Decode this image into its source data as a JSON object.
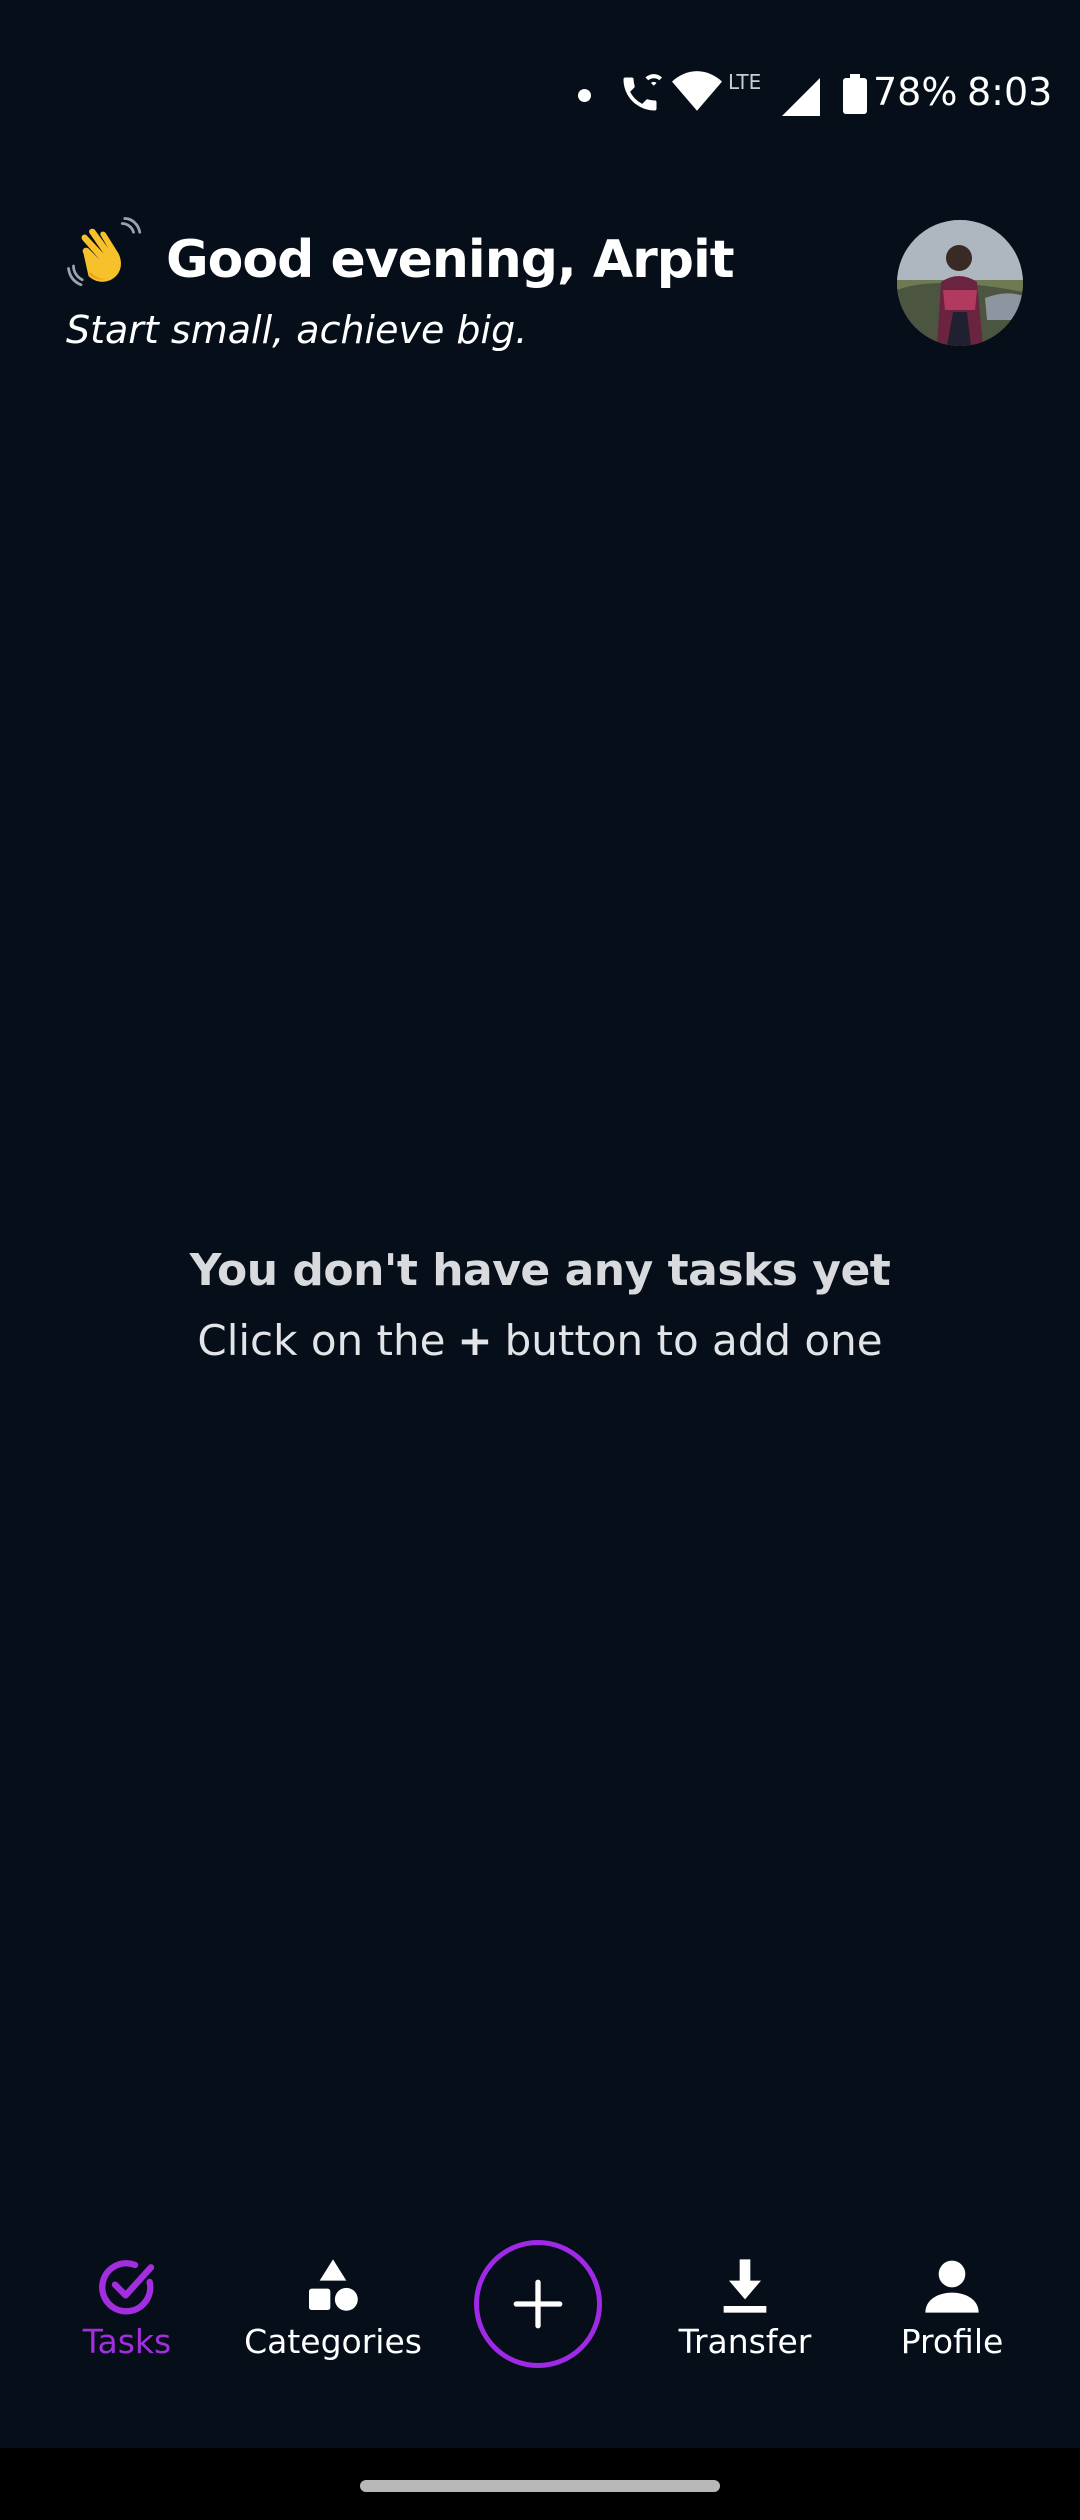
{
  "status_bar": {
    "lte_label": "LTE",
    "battery_percent": "78%",
    "time": "8:03"
  },
  "header": {
    "greeting": "Good evening, Arpit",
    "tagline": "Start small, achieve big.",
    "greeting_icon": "waving-hand-icon",
    "avatar": "profile-avatar"
  },
  "empty_state": {
    "title": "You don't have any tasks yet",
    "hint_prefix": "Click on the",
    "hint_symbol": "+",
    "hint_suffix": "button to add one"
  },
  "bottom_nav": {
    "items": [
      {
        "label": "Tasks",
        "icon": "check-circle-icon",
        "active": true
      },
      {
        "label": "Categories",
        "icon": "shapes-icon",
        "active": false
      },
      {
        "label": "Transfer",
        "icon": "download-icon",
        "active": false
      },
      {
        "label": "Profile",
        "icon": "person-icon",
        "active": false
      }
    ],
    "add_icon": "plus-icon"
  },
  "colors": {
    "background": "#050e19",
    "accent": "#a32ee0",
    "text": "#ffffff"
  }
}
